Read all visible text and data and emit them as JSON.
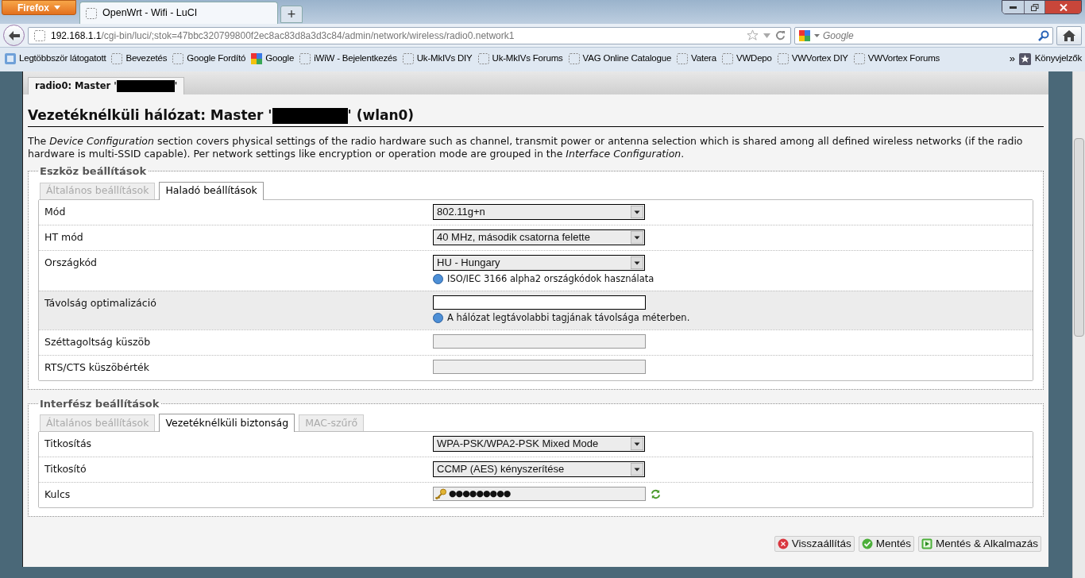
{
  "browser": {
    "menu_button": "Firefox",
    "tabs": [
      {
        "title": "OpenWrt - Wifi - LuCI",
        "selected": true
      }
    ],
    "new_tab": "+",
    "url_host": "192.168.1.1",
    "url_path": "/cgi-bin/luci/;stok=47bbc320799800f2ec8ac83d8a3d3c84/admin/network/wireless/radio0.network1",
    "search_placeholder": "Google",
    "bookmarks": [
      {
        "label": "Legtöbbször látogatott",
        "kind": "smart"
      },
      {
        "label": "Bevezetés",
        "kind": "page"
      },
      {
        "label": "Google Fordító",
        "kind": "page"
      },
      {
        "label": "Google",
        "kind": "google"
      },
      {
        "label": "iWiW - Bejelentkezés",
        "kind": "page"
      },
      {
        "label": "Uk-MkIVs DIY",
        "kind": "page"
      },
      {
        "label": "Uk-MkIVs Forums",
        "kind": "page"
      },
      {
        "label": "VAG Online Catalogue",
        "kind": "page"
      },
      {
        "label": "Vatera",
        "kind": "page"
      },
      {
        "label": "VWDepo",
        "kind": "page"
      },
      {
        "label": "VWVortex DIY",
        "kind": "page"
      },
      {
        "label": "VWVortex Forums",
        "kind": "page"
      }
    ],
    "more_bookmarks": "»",
    "bookmarks_menu": "Könyvjelzők"
  },
  "page": {
    "tabs": [
      {
        "label_prefix": "radio0: Master '",
        "label_suffix": "'",
        "selected": true
      }
    ],
    "title_prefix": "Vezetéknélküli hálózat: Master '",
    "title_suffix": "' (wlan0)",
    "description": "The *Device Configuration* section covers physical settings of the radio hardware such as channel, transmit power or antenna selection which is shared among all defined wireless networks (if the radio hardware is multi-SSID capable). Per network settings like encryption or operation mode are grouped in the *Interface Configuration*.",
    "sections": [
      {
        "legend": "Eszköz beállítások",
        "tabs": [
          {
            "label": "Általános beállítások",
            "selected": false
          },
          {
            "label": "Haladó beállítások",
            "selected": true
          }
        ],
        "fields": [
          {
            "label": "Mód",
            "kind": "select",
            "value": "802.11g+n",
            "shaded": false
          },
          {
            "label": "HT mód",
            "kind": "select",
            "value": "40 MHz, második csatorna felette",
            "shaded": false
          },
          {
            "label": "Országkód",
            "kind": "select",
            "value": "HU - Hungary",
            "help": "ISO/IEC 3166 alpha2 országkódok használata",
            "shaded": false
          },
          {
            "label": "Távolság optimalizáció",
            "kind": "text",
            "help": "A hálózat legtávolabbi tagjának távolsága méterben.",
            "shaded": true
          },
          {
            "label": "Széttagoltság küszöb",
            "kind": "text",
            "disabled": true,
            "shaded": false
          },
          {
            "label": "RTS/CTS küszöbérték",
            "kind": "text",
            "disabled": true,
            "shaded": false
          }
        ]
      },
      {
        "legend": "Interfész beállítások",
        "tabs": [
          {
            "label": "Általános beállítások",
            "selected": false
          },
          {
            "label": "Vezetéknélküli biztonság",
            "selected": true
          },
          {
            "label": "MAC-szűrő",
            "selected": false
          }
        ],
        "fields": [
          {
            "label": "Titkosítás",
            "kind": "select",
            "value": "WPA-PSK/WPA2-PSK Mixed Mode",
            "shaded": false
          },
          {
            "label": "Titkosító",
            "kind": "select",
            "value": "CCMP (AES) kényszerítése",
            "shaded": false
          },
          {
            "label": "Kulcs",
            "kind": "password",
            "value": "●●●●●●●●●",
            "shaded": false
          }
        ]
      }
    ],
    "buttons": [
      {
        "label": "Visszaállítás",
        "kind": "reset"
      },
      {
        "label": "Mentés",
        "kind": "save"
      },
      {
        "label": "Mentés & Alkalmazás",
        "kind": "apply"
      }
    ]
  }
}
